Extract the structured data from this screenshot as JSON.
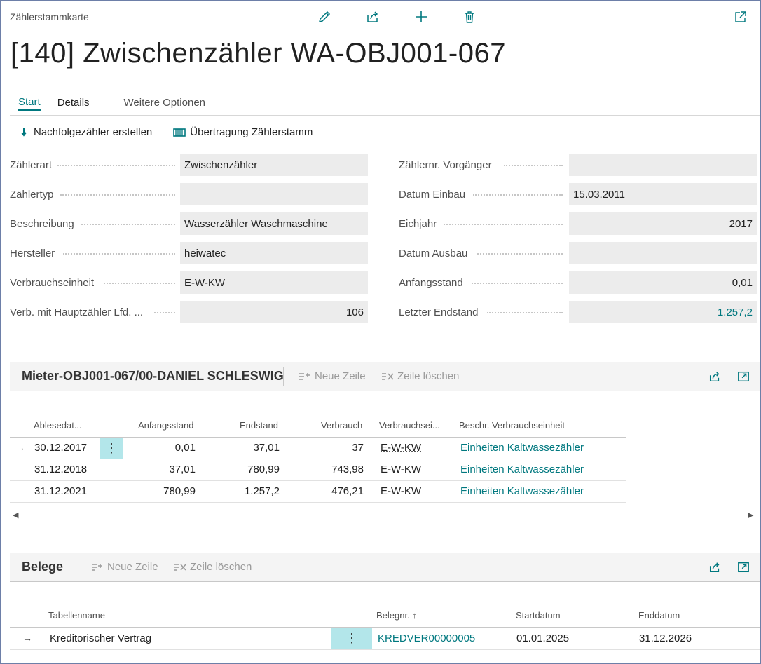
{
  "header": {
    "caption": "Zählerstammkarte",
    "title": "[140] Zwischenzähler WA-OBJ001-067",
    "icons": [
      "pencil-icon",
      "share-icon",
      "plus-icon",
      "trash-icon",
      "popout-icon"
    ]
  },
  "tabs": [
    {
      "label": "Start"
    },
    {
      "label": "Details"
    },
    {
      "label": "Weitere Optionen"
    }
  ],
  "actions": [
    {
      "label": "Nachfolgezähler erstellen",
      "icon": "arrow-down-icon"
    },
    {
      "label": "Übertragung Zählerstamm",
      "icon": "transfer-icon"
    }
  ],
  "fields": {
    "left": [
      {
        "label": "Zählerart",
        "value": "Zwischenzähler"
      },
      {
        "label": "Zählertyp",
        "value": ""
      },
      {
        "label": "Beschreibung",
        "value": "Wasserzähler Waschmaschine"
      },
      {
        "label": "Hersteller",
        "value": "heiwatec"
      },
      {
        "label": "Verbrauchseinheit",
        "value": "E-W-KW"
      },
      {
        "label": "Verb. mit Hauptzähler Lfd. ...",
        "value": "106"
      }
    ],
    "right": [
      {
        "label": "Zählernr. Vorgänger",
        "value": ""
      },
      {
        "label": "Datum Einbau",
        "value": "15.03.2011"
      },
      {
        "label": "Eichjahr",
        "value": "2017"
      },
      {
        "label": "Datum Ausbau",
        "value": ""
      },
      {
        "label": "Anfangsstand",
        "value": "0,01"
      },
      {
        "label": "Letzter Endstand",
        "value": "1.257,2"
      }
    ]
  },
  "readings": {
    "title": "Mieter-OBJ001-067/00-DANIEL SCHLESWIG",
    "new_line": "Neue Zeile",
    "delete_line": "Zeile löschen",
    "columns": [
      "Ablesedat...",
      "Anfangsstand",
      "Endstand",
      "Verbrauch",
      "Verbrauchsei...",
      "Beschr. Verbrauchseinheit"
    ],
    "rows": [
      [
        "30.12.2017",
        "0,01",
        "37,01",
        "37",
        "E-W-KW",
        "Einheiten Kaltwassezähler"
      ],
      [
        "31.12.2018",
        "37,01",
        "780,99",
        "743,98",
        "E-W-KW",
        "Einheiten Kaltwassezähler"
      ],
      [
        "31.12.2021",
        "780,99",
        "1.257,2",
        "476,21",
        "E-W-KW",
        "Einheiten Kaltwassezähler"
      ]
    ],
    "kebab": "⋮",
    "arrow": "→"
  },
  "documents": {
    "title": "Belege",
    "new_line": "Neue Zeile",
    "delete_line": "Zeile löschen",
    "columns": [
      "Tabellenname",
      "Belegnr. ↑",
      "Startdatum",
      "Enddatum"
    ],
    "rows": [
      [
        "Kreditorischer Vertrag",
        "KREDVER00000005",
        "01.01.2025",
        "31.12.2026"
      ]
    ],
    "kebab": "⋮",
    "arrow": "→"
  },
  "colors": {
    "accent": "#00787f",
    "field_bg": "#ececec",
    "selected_cell": "#b3e6ea",
    "frame": "#6d7fa8"
  }
}
